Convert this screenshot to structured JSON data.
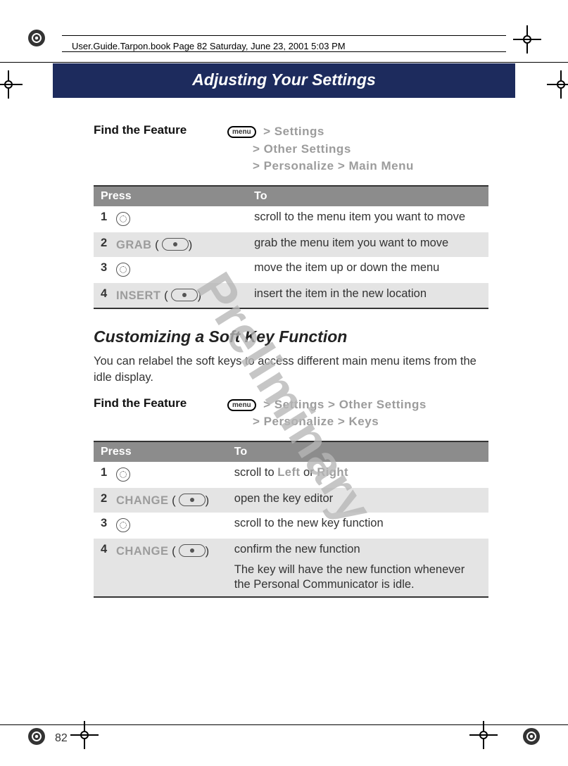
{
  "book_header": "User.Guide.Tarpon.book  Page 82  Saturday, June 23, 2001  5:03 PM",
  "chapter_title": "Adjusting Your Settings",
  "watermark": "Preliminary",
  "page_number": "82",
  "menu_button_label": "menu",
  "feature1": {
    "find_label": "Find the Feature",
    "path_lines": [
      "> Settings",
      "> Other Settings",
      "> Personalize > Main Menu"
    ],
    "table": {
      "head_press": "Press",
      "head_to": "To",
      "rows": [
        {
          "num": "1",
          "press_lcd": "",
          "press_icon": "nav",
          "to": "scroll to the menu item you want to move"
        },
        {
          "num": "2",
          "press_lcd": "GRAB",
          "press_icon": "softkey",
          "to": "grab the menu item you want to move"
        },
        {
          "num": "3",
          "press_lcd": "",
          "press_icon": "nav",
          "to": "move the item up or down the menu"
        },
        {
          "num": "4",
          "press_lcd": "INSERT",
          "press_icon": "softkey",
          "to": "insert the item in the new location"
        }
      ]
    }
  },
  "section2_heading": "Customizing a Soft Key Function",
  "section2_body": "You can relabel the soft keys to access different main menu items from the idle display.",
  "feature2": {
    "find_label": "Find the Feature",
    "path_lines": [
      "> Settings > Other Settings",
      "> Personalize > Keys"
    ],
    "table": {
      "head_press": "Press",
      "head_to": "To",
      "rows": [
        {
          "num": "1",
          "press_lcd": "",
          "press_icon": "nav",
          "to_html": "scroll to <span class='lcd'>Left</span> or <span class='lcd'>Right</span>",
          "to": "scroll to Left or Right"
        },
        {
          "num": "2",
          "press_lcd": "CHANGE",
          "press_icon": "softkey",
          "to": "open the key editor"
        },
        {
          "num": "3",
          "press_lcd": "",
          "press_icon": "nav",
          "to": "scroll to the new key function"
        },
        {
          "num": "4",
          "press_lcd": "CHANGE",
          "press_icon": "softkey",
          "to": "confirm the new function",
          "extra": "The key will have the new function whenever the Personal Communicator is idle."
        }
      ]
    }
  }
}
